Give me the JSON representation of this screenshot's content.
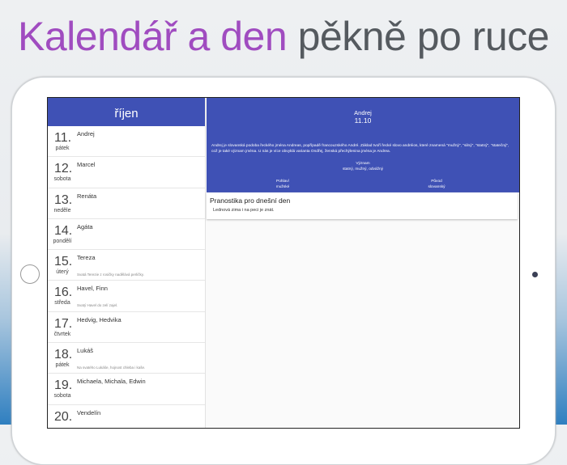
{
  "headline": {
    "part1": "Kalendář a den",
    "part2": "pěkně po ruce"
  },
  "list": {
    "month": "říjen",
    "items": [
      {
        "num": "11.",
        "day": "pátek",
        "name": "Andrej",
        "note": ""
      },
      {
        "num": "12.",
        "day": "sobota",
        "name": "Marcel",
        "note": ""
      },
      {
        "num": "13.",
        "day": "neděle",
        "name": "Renáta",
        "note": ""
      },
      {
        "num": "14.",
        "day": "pondělí",
        "name": "Agáta",
        "note": ""
      },
      {
        "num": "15.",
        "day": "úterý",
        "name": "Tereza",
        "note": "Svatá Terezie z rosičky nadělává perličky."
      },
      {
        "num": "16.",
        "day": "středa",
        "name": "Havel, Finn",
        "note": "Svatý Havel do zelí zajel."
      },
      {
        "num": "17.",
        "day": "čtvrtek",
        "name": "Hedvig, Hedvika",
        "note": ""
      },
      {
        "num": "18.",
        "day": "pátek",
        "name": "Lukáš",
        "note": "Na svatého Lukáše, hojnost chleba i kaše."
      },
      {
        "num": "19.",
        "day": "sobota",
        "name": "Michaela, Michala, Edwin",
        "note": ""
      },
      {
        "num": "20.",
        "day": "",
        "name": "Vendelín",
        "note": ""
      }
    ]
  },
  "detail": {
    "name": "Andrej",
    "date": "11.10",
    "description": "Andrej je slovanská podoba řeckého jména Andreas, popřípadě francouzského André. Základ tvoří řecké slovo andréios, které znamená \"mužný\", \"silný\", \"statný\", \"statečný\", což je také význam jména. U nás je více obvyklá varianta Ondřej, ženská přechýlenina jména je Andrea.",
    "meaning_label": "Význam",
    "meaning": "statný, mužný, odvážný",
    "gender_label": "Pohlaví",
    "gender": "mužské",
    "origin_label": "Původ",
    "origin": "slovanský"
  },
  "saying": {
    "title": "Pranostika pro dnešní den",
    "text": "Lednová zima i na peci je znát."
  },
  "colors": {
    "primary": "#3f51b5",
    "accent": "#a04cc0"
  }
}
